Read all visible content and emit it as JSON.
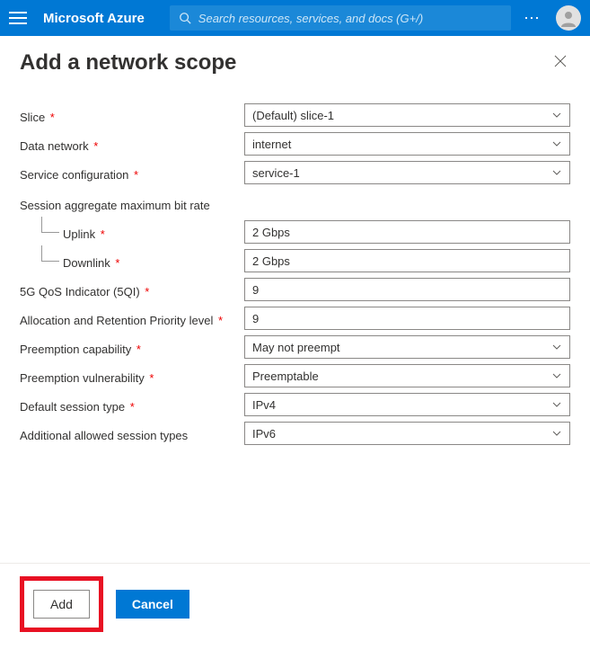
{
  "topbar": {
    "brand": "Microsoft Azure",
    "search_placeholder": "Search resources, services, and docs (G+/)"
  },
  "page": {
    "title": "Add a network scope"
  },
  "form": {
    "slice": {
      "label": "Slice",
      "value": "(Default) slice-1"
    },
    "data_network": {
      "label": "Data network",
      "value": "internet"
    },
    "service_configuration": {
      "label": "Service configuration",
      "value": "service-1"
    },
    "session_aggregate": {
      "label": "Session aggregate maximum bit rate"
    },
    "uplink": {
      "label": "Uplink",
      "value": "2 Gbps"
    },
    "downlink": {
      "label": "Downlink",
      "value": "2 Gbps"
    },
    "qos_indicator": {
      "label": "5G QoS Indicator (5QI)",
      "value": "9"
    },
    "arp_level": {
      "label": "Allocation and Retention Priority level",
      "value": "9"
    },
    "preemption_capability": {
      "label": "Preemption capability",
      "value": "May not preempt"
    },
    "preemption_vulnerability": {
      "label": "Preemption vulnerability",
      "value": "Preemptable"
    },
    "default_session_type": {
      "label": "Default session type",
      "value": "IPv4"
    },
    "additional_session_types": {
      "label": "Additional allowed session types",
      "value": "IPv6"
    }
  },
  "footer": {
    "add": "Add",
    "cancel": "Cancel"
  }
}
